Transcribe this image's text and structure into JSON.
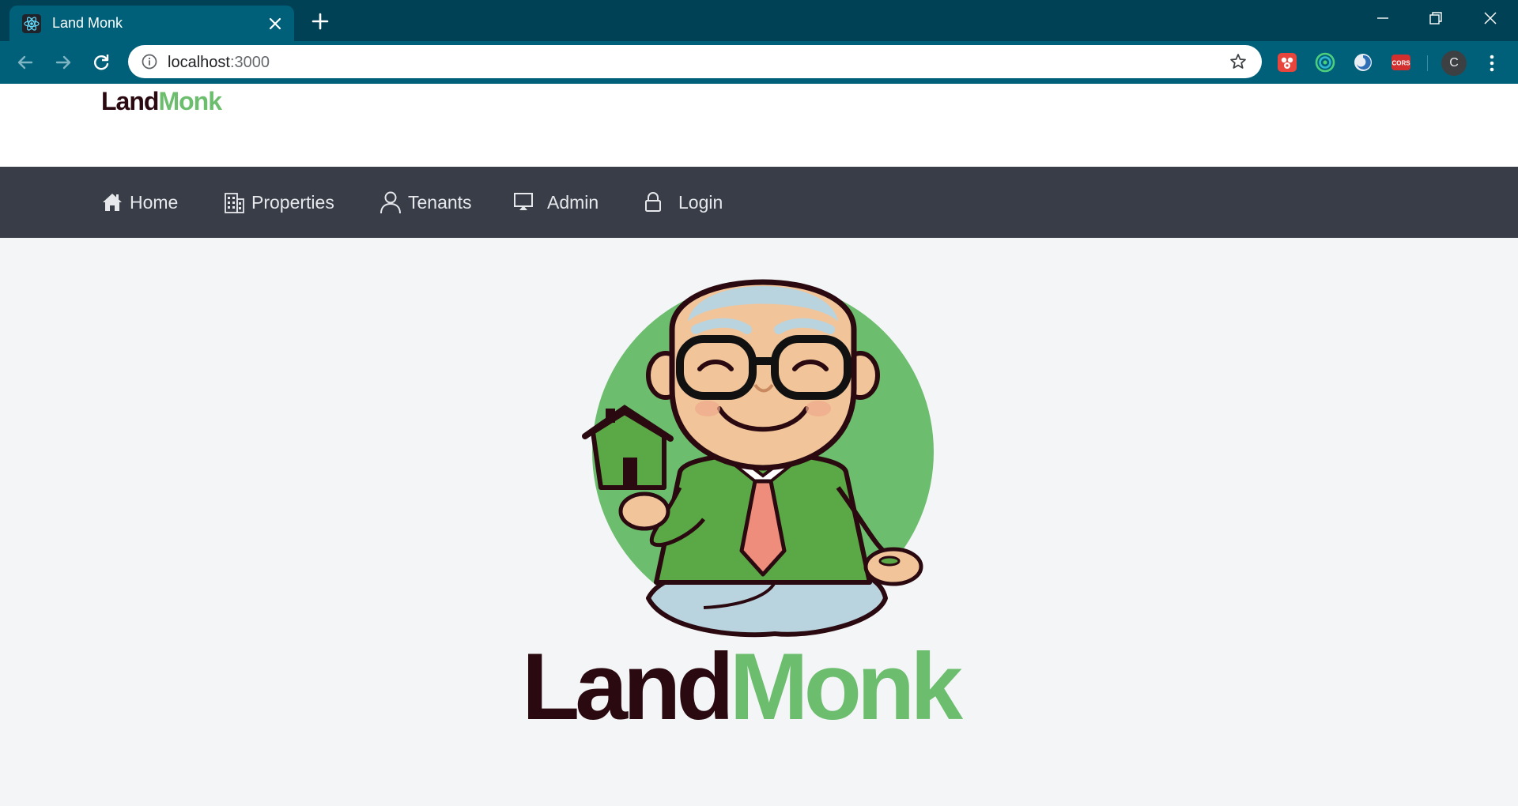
{
  "browser": {
    "tab_title": "Land Monk",
    "url_host": "localhost",
    "url_port": ":3000",
    "profile_initial": "C",
    "extensions": [
      "bug-extension-icon",
      "target-extension-icon",
      "swirl-extension-icon",
      "cors-extension-icon"
    ],
    "cors_label": "CORS"
  },
  "site": {
    "logo_land": "Land",
    "logo_monk": "Monk"
  },
  "nav": {
    "items": [
      {
        "label": "Home",
        "icon": "home-icon"
      },
      {
        "label": "Properties",
        "icon": "building-icon"
      },
      {
        "label": "Tenants",
        "icon": "user-icon"
      },
      {
        "label": "Admin",
        "icon": "monitor-icon"
      },
      {
        "label": "Login",
        "icon": "lock-icon"
      }
    ]
  },
  "hero": {
    "logo_land": "Land",
    "logo_monk": "Monk"
  },
  "colors": {
    "chrome_dark": "#004155",
    "chrome_tab": "#006079",
    "navbar": "#383d47",
    "brand_green": "#6cbe6e",
    "brand_dark": "#2a0a10"
  }
}
